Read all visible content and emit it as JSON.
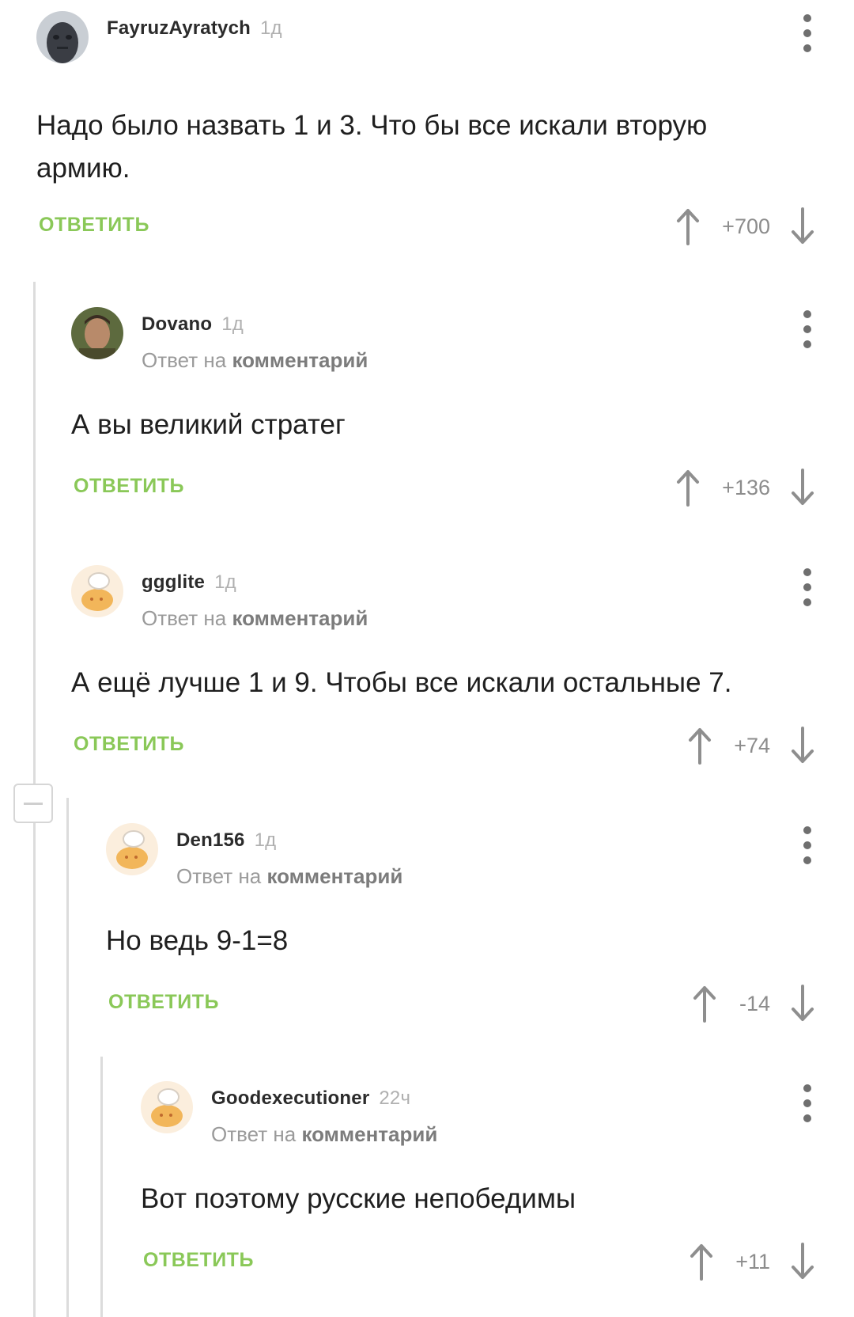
{
  "comments": [
    {
      "author": "FayruzAyratych",
      "time": "1д",
      "reply_prefix": "",
      "reply_link": "",
      "text": "Надо было назвать 1 и 3. Что бы все искали вторую армию.",
      "reply_label": "ОТВЕТИТЬ",
      "rating": "+700"
    },
    {
      "author": "Dovano",
      "time": "1д",
      "reply_prefix": "Ответ на",
      "reply_link": "комментарий",
      "text": "А вы великий стратег",
      "reply_label": "ОТВЕТИТЬ",
      "rating": "+136"
    },
    {
      "author": "ggglite",
      "time": "1д",
      "reply_prefix": "Ответ на",
      "reply_link": "комментарий",
      "text": "А ещё лучше 1 и 9. Чтобы все искали остальные 7.",
      "reply_label": "ОТВЕТИТЬ",
      "rating": "+74"
    },
    {
      "author": "Den156",
      "time": "1д",
      "reply_prefix": "Ответ на",
      "reply_link": "комментарий",
      "text": "Но ведь 9-1=8",
      "reply_label": "ОТВЕТИТЬ",
      "rating": "-14"
    },
    {
      "author": "Goodexecutioner",
      "time": "22ч",
      "reply_prefix": "Ответ на",
      "reply_link": "комментарий",
      "text": "Вот поэтому русские непобедимы",
      "reply_label": "ОТВЕТИТЬ",
      "rating": "+11"
    }
  ],
  "icons": {
    "more": "more-vertical-icon",
    "upvote": "arrow-up-icon",
    "downvote": "arrow-down-icon",
    "collapse": "minus-icon"
  },
  "colors": {
    "reply": "#8ac858",
    "thread_line": "#dcdcdc",
    "rating": "#8c8c8c"
  }
}
